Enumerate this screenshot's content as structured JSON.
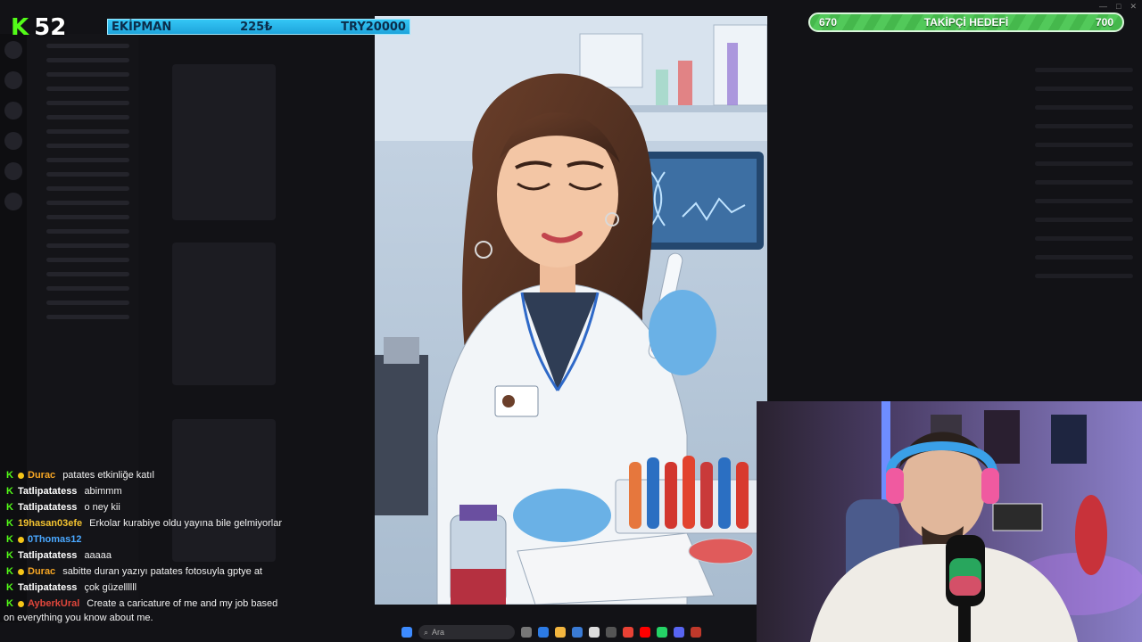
{
  "overlay": {
    "k_icon": "K",
    "k_count": "52",
    "team": {
      "name": "EKİPMAN",
      "amount": "225₺",
      "goal": "TRY20000"
    },
    "follower_goal": {
      "current": "670",
      "title": "TAKİPÇİ HEDEFİ",
      "target": "700"
    }
  },
  "window_controls": [
    "—",
    "□",
    "✕"
  ],
  "chat": {
    "messages": [
      {
        "user": "Durac",
        "color": "#f5a524",
        "badge": "dot",
        "text": "patates etkinliğe katıl"
      },
      {
        "user": "Tatlipatatess",
        "color": "#ffffff",
        "badge": "",
        "text": "abimmm"
      },
      {
        "user": "Tatlipatatess",
        "color": "#ffffff",
        "badge": "",
        "text": "o ney kii"
      },
      {
        "user": "19hasan03efe",
        "color": "#f2c230",
        "badge": "",
        "text": "Erkolar kurabiye oldu yayına bile gelmiyorlar"
      },
      {
        "user": "0Thomas12",
        "color": "#4aa8ff",
        "badge": "dot",
        "text": ""
      },
      {
        "user": "Tatlipatatess",
        "color": "#ffffff",
        "badge": "",
        "text": "aaaaa"
      },
      {
        "user": "Durac",
        "color": "#f5a524",
        "badge": "dot",
        "text": "sabitte duran yazıyı patates fotosuyla gptye at"
      },
      {
        "user": "Tatlipatatess",
        "color": "#ffffff",
        "badge": "",
        "text": "çok güzellllll"
      },
      {
        "user": "AyberkUral",
        "color": "#e0463b",
        "badge": "dot",
        "text": "Create a caricature of me and my job based"
      }
    ],
    "wrap_line": "on everything you know about me."
  },
  "taskbar": {
    "search_placeholder": "Ara"
  },
  "colors": {
    "kick_green": "#53fc18",
    "goal_green": "#4cbf53",
    "team_blue": "#27b4ea"
  }
}
